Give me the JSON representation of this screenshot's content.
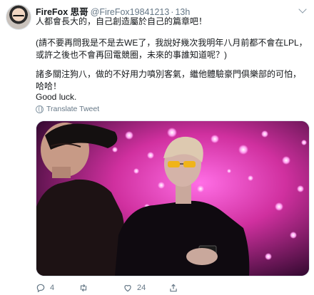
{
  "tweet": {
    "display_name": "FireFox 思哥",
    "handle": "@FireFox19841213",
    "separator": "·",
    "timestamp": "13h",
    "paragraphs": [
      "人都會長大的，自己創造屬於自己的篇章吧！",
      "(請不要再問我是不是去WE了，我說好幾次我明年八月前都不會在LPL，或許之後也不會再回電競圈，未來的事誰知道呢？)",
      "諸多關注狗八，做的不好用力噴別客氣，繼他體驗豪門俱樂部的可怕，哈哈！",
      "Good luck."
    ],
    "translate_label": "Translate Tweet",
    "replies": "4",
    "retweets": "",
    "likes": "24"
  },
  "colors": {
    "text": "#14171a",
    "secondary": "#657786",
    "photo_pink": "#e640c8"
  },
  "icons": {
    "reply": "reply-icon",
    "retweet": "retweet-icon",
    "like": "heart-icon",
    "share": "share-icon",
    "translate": "globe-icon",
    "more": "chevron-down-icon"
  }
}
